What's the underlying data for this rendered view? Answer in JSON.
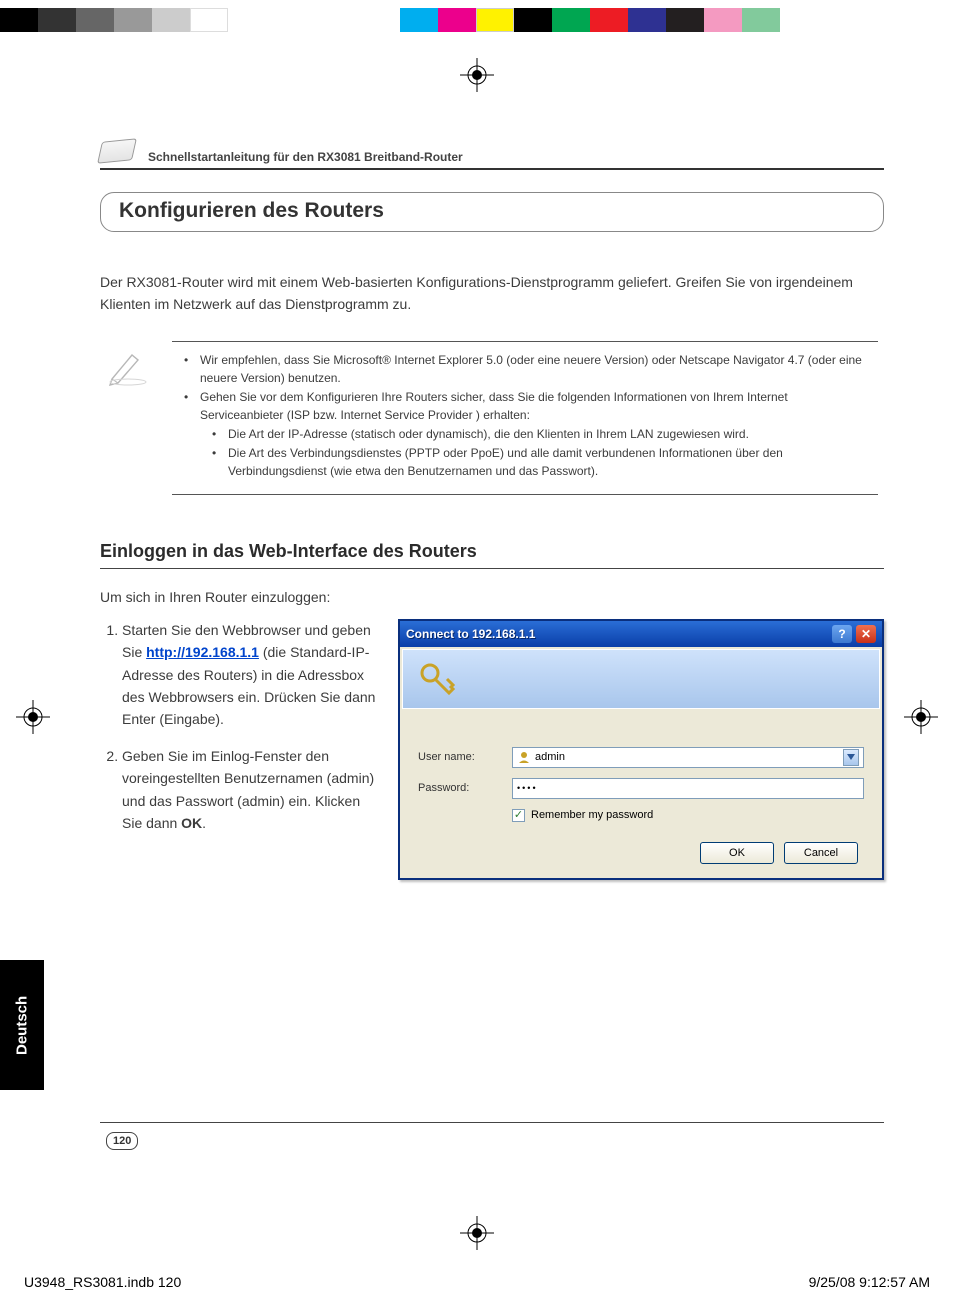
{
  "header": {
    "doc_title": "Schnellstartanleitung für den RX3081 Breitband-Router"
  },
  "section_heading": "Konfigurieren des Routers",
  "intro": "Der RX3081-Router wird mit einem Web-basierten Konfigurations-Dienstprogramm geliefert. Greifen Sie von irgendeinem Klienten im Netzwerk auf das Dienstprogramm zu.",
  "note": {
    "items": [
      "Wir empfehlen, dass Sie Microsoft®  Internet Explorer 5.0 (oder eine neuere Version) oder Netscape Navigator 4.7 (oder eine neuere Version) benutzen.",
      "Gehen Sie vor dem Konfigurieren Ihre Routers sicher, dass Sie die folgenden Informationen von Ihrem Internet Serviceanbieter (ISP bzw. Internet Service Provider ) erhalten:"
    ],
    "subitems": [
      "Die Art der IP-Adresse (statisch oder dynamisch), die den Klienten in Ihrem LAN zugewiesen wird.",
      "Die Art des Verbindungsdienstes (PPTP oder PpoE) und alle damit verbundenen Informationen über den Verbindungsdienst (wie etwa den Benutzernamen und das Passwort)."
    ]
  },
  "subheading": "Einloggen in das Web-Interface des Routers",
  "steps": {
    "lead": "Um sich in Ihren Router einzuloggen:",
    "s1_a": "Starten Sie den Webbrowser und geben Sie ",
    "s1_link": "http://192.168.1.1",
    "s1_b": " (die Standard-IP-Adresse des Routers) in die Adressbox des Webbrowsers ein. Drücken Sie dann Enter (Eingabe).",
    "s2_a": "Geben Sie im Einlog-Fenster den voreingestellten Benutzernamen (admin) und das Passwort (admin) ein. Klicken Sie dann ",
    "s2_bold": "OK",
    "s2_b": "."
  },
  "dialog": {
    "title": "Connect to 192.168.1.1",
    "user_label": "User name:",
    "user_value": "admin",
    "pwd_label": "Password:",
    "pwd_value": "••••",
    "remember": "Remember my password",
    "ok": "OK",
    "cancel": "Cancel"
  },
  "side_tab": "Deutsch",
  "page_number": "120",
  "print_footer": {
    "left": "U3948_RS3081.indb   120",
    "right": "9/25/08   9:12:57 AM"
  }
}
